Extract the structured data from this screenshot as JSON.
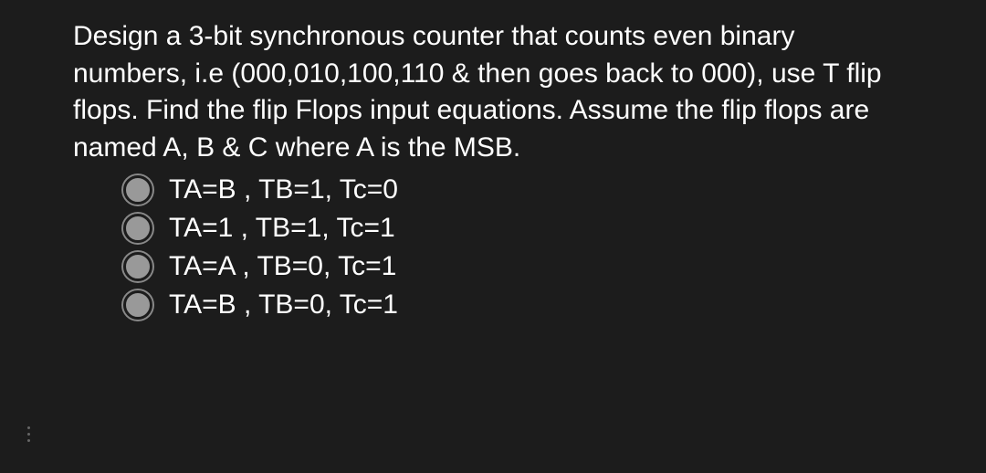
{
  "question": {
    "text": "Design a 3-bit synchronous counter that counts even binary numbers, i.e (000,010,100,110 & then goes back to 000), use T flip flops. Find the flip Flops input equations. Assume the flip flops are named A, B & C where A is the MSB."
  },
  "options": [
    {
      "label": "TA=B , TB=1, Tc=0"
    },
    {
      "label": "TA=1 , TB=1, Tc=1"
    },
    {
      "label": "TA=A , TB=0, Tc=1"
    },
    {
      "label": "TA=B , TB=0, Tc=1"
    }
  ]
}
